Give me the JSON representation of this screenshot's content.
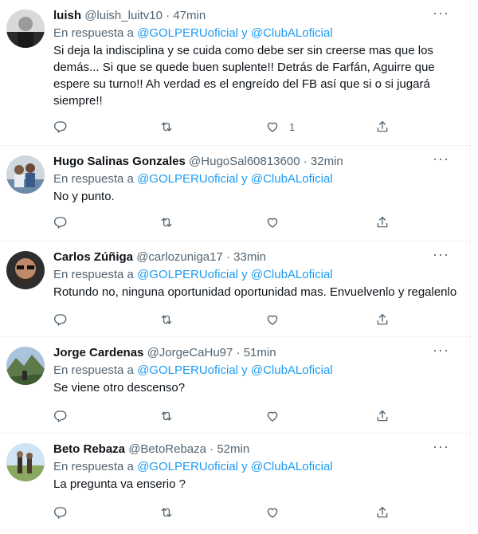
{
  "reply_prefix": "En respuesta a",
  "mentions": "@GOLPERUoficial y @ClubALoficial",
  "more_label": "···",
  "separator": "·",
  "tweets": [
    {
      "name": "luish",
      "handle": "@luish_luitv10",
      "time": "47min",
      "text": "Si deja la indisciplina y se cuida como debe ser sin creerse mas que los demás... Si que se quede buen suplente!! Detrás de Farfán, Aguirre que espere su turno!! Ah verdad es el engreído del FB así que si o si jugará siempre!!",
      "like_count": "1"
    },
    {
      "name": "Hugo Salinas Gonzales",
      "handle": "@HugoSal60813600",
      "time": "32min",
      "text": "No y punto.",
      "like_count": ""
    },
    {
      "name": "Carlos Zúñiga",
      "handle": "@carlozuniga17",
      "time": "33min",
      "text": "Rotundo no, ninguna oportunidad oportunidad mas. Envuelvenlo y regalenlo",
      "like_count": ""
    },
    {
      "name": "Jorge Cardenas",
      "handle": "@JorgeCaHu97",
      "time": "51min",
      "text": "Se viene otro descenso?",
      "like_count": ""
    },
    {
      "name": "Beto Rebaza",
      "handle": "@BetoRebaza",
      "time": "52min",
      "text": "La pregunta va enserio ?",
      "like_count": ""
    }
  ],
  "icons": {
    "reply": "reply-icon",
    "retweet": "retweet-icon",
    "like": "like-icon",
    "share": "share-icon"
  }
}
